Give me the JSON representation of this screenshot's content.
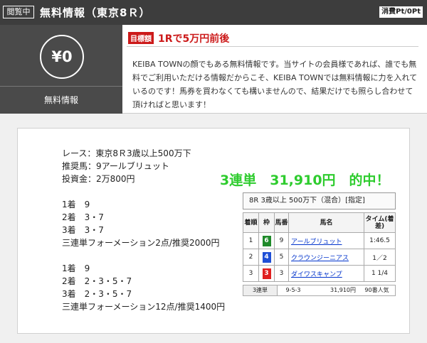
{
  "header": {
    "browsing_label": "閲覧中",
    "title": "無料情報（東京8Ｒ）",
    "points": "消費Pt/0Pt"
  },
  "info": {
    "price": "¥0",
    "price_label": "無料情報",
    "target_badge": "目標額",
    "target_text": "1Rで5万円前後",
    "description": "KEIBA TOWNの顔でもある無料情報です。当サイトの会員様であれば、誰でも無料でご利用いただける情報だからこそ、KEIBA TOWNでは無料情報に力を入れているのです！馬券を買わなくても構いませんので、結果だけでも照らし合わせて頂ければと思います！"
  },
  "race": {
    "race_line": "レース：東京8Ｒ3歳以上500万下",
    "horse_line": "推奨馬：9アールブリュット",
    "investment_line": "投資金：2万800円"
  },
  "bets": [
    {
      "first": "1着　9",
      "second": "2着　3・7",
      "third": "3着　3・7",
      "formation": "三連単フォーメーション2点/推奨2000円"
    },
    {
      "first": "1着　9",
      "second": "2着　2・3・5・7",
      "third": "3着　2・3・5・7",
      "formation": "三連単フォーメーション12点/推奨1400円"
    }
  ],
  "hit": "3連単　31,910円　的中！",
  "result": {
    "title": "8R 3歳以上 500万下（混合）[指定]",
    "headers": [
      "着順",
      "枠",
      "馬番",
      "馬名",
      "タイム(着差)"
    ],
    "rows": [
      {
        "rank": "1",
        "frame": "6",
        "frame_color": "#1f8a2a",
        "number": "9",
        "horse": "アールブリュット",
        "time": "1:46.5"
      },
      {
        "rank": "2",
        "frame": "4",
        "frame_color": "#1f4fd6",
        "number": "5",
        "horse": "クラウンジーニアス",
        "time": "1／2"
      },
      {
        "rank": "3",
        "frame": "3",
        "frame_color": "#e02020",
        "number": "3",
        "horse": "ダイワスキャンプ",
        "time": "1 1/4"
      }
    ],
    "payout": {
      "type": "3連単",
      "combo": "9-5-3",
      "amount": "31,910円",
      "popularity": "90番人気"
    }
  },
  "colors": {
    "header_bg": "#3d3d3d",
    "accent_red": "#cc1a1a",
    "hit_green": "#2ecc2e"
  }
}
